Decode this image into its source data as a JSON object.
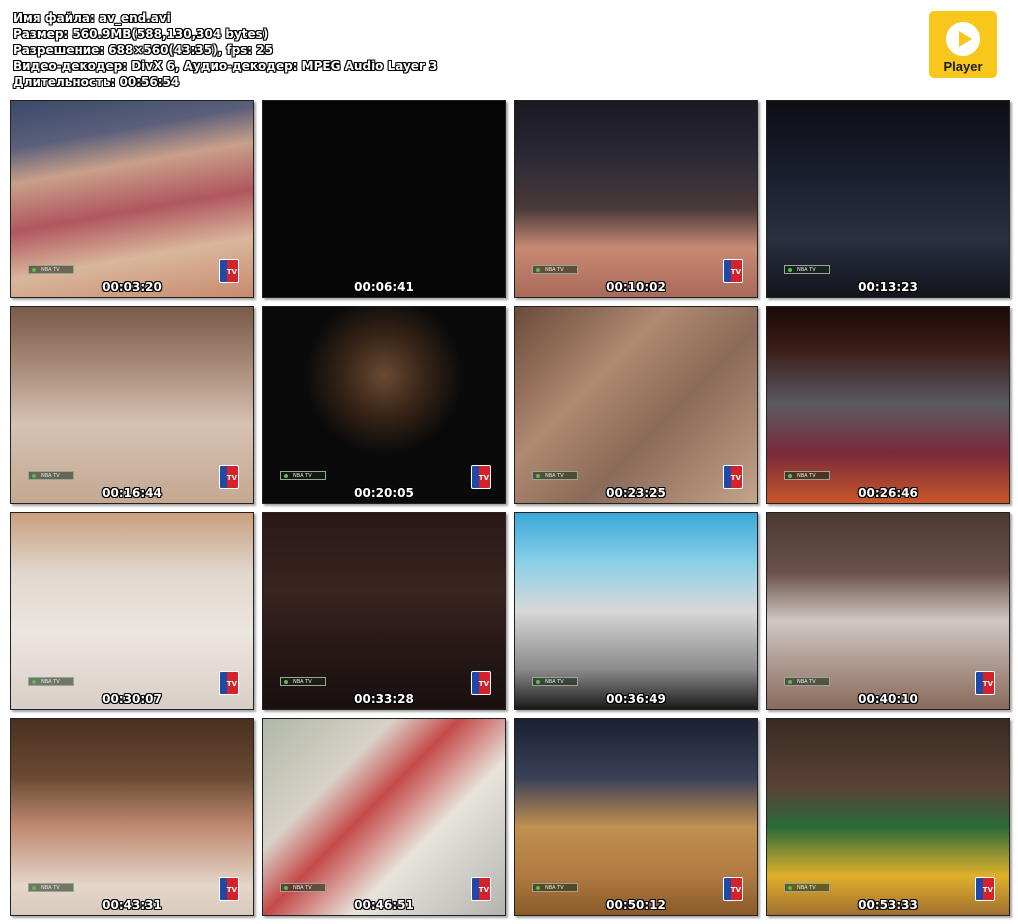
{
  "info": {
    "filename": "Имя файла: av_end.avi",
    "size": "Размер: 560.9MB(588,130,304 bytes)",
    "resolution": "Разрешение: 688×560(43:35), fps: 25",
    "codecs": "Видео-декодер: DivX 6, Аудио-декодер: MPEG Audio Layer 3",
    "duration": "Длительность: 00:56:54"
  },
  "player_button": {
    "label": "Player",
    "icon": "play-icon",
    "color": "#f7c81b"
  },
  "bug_text": "NBA TV",
  "logo_text": "TV",
  "thumbnails": [
    {
      "timestamp": "00:03:20",
      "scene": "court-red-blue"
    },
    {
      "timestamp": "00:06:41",
      "scene": "black"
    },
    {
      "timestamp": "00:10:02",
      "scene": "arena-court"
    },
    {
      "timestamp": "00:13:23",
      "scene": "dark-arena"
    },
    {
      "timestamp": "00:16:44",
      "scene": "players-fight"
    },
    {
      "timestamp": "00:20:05",
      "scene": "interview-green"
    },
    {
      "timestamp": "00:23:25",
      "scene": "sepia-crowd"
    },
    {
      "timestamp": "00:26:46",
      "scene": "tunnel-red"
    },
    {
      "timestamp": "00:30:07",
      "scene": "light-court"
    },
    {
      "timestamp": "00:33:28",
      "scene": "dark-crowd"
    },
    {
      "timestamp": "00:36:49",
      "scene": "portland-vs"
    },
    {
      "timestamp": "00:40:10",
      "scene": "courtside-white"
    },
    {
      "timestamp": "00:43:31",
      "scene": "interview-man"
    },
    {
      "timestamp": "00:46:51",
      "scene": "celtics-bench"
    },
    {
      "timestamp": "00:50:12",
      "scene": "lakers-court"
    },
    {
      "timestamp": "00:53:33",
      "scene": "bird-johnson"
    }
  ]
}
